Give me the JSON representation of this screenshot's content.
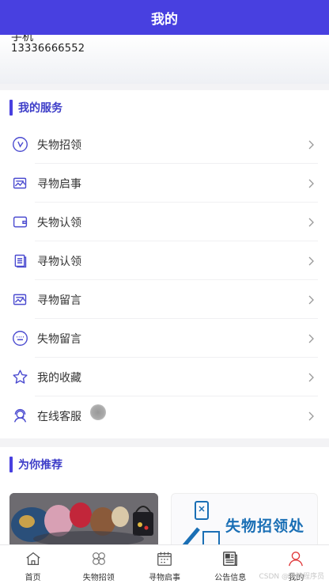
{
  "header": {
    "title": "我的"
  },
  "profile": {
    "name": "手机",
    "phone": "13336666552"
  },
  "services": {
    "title": "我的服务",
    "items": [
      {
        "label": "失物招领",
        "icon": "clock-circle-icon"
      },
      {
        "label": "寻物启事",
        "icon": "image-chart-icon"
      },
      {
        "label": "失物认领",
        "icon": "wallet-icon"
      },
      {
        "label": "寻物认领",
        "icon": "document-icon"
      },
      {
        "label": "寻物留言",
        "icon": "image-chart-icon"
      },
      {
        "label": "失物留言",
        "icon": "keyboard-circle-icon"
      },
      {
        "label": "我的收藏",
        "icon": "star-icon"
      },
      {
        "label": "在线客服",
        "icon": "headset-user-icon"
      }
    ]
  },
  "recommend": {
    "title": "为你推荐",
    "cards": [
      {
        "label": ""
      },
      {
        "label": "失物招领处"
      }
    ]
  },
  "tabbar": {
    "items": [
      {
        "label": "首页",
        "icon": "home-icon"
      },
      {
        "label": "失物招领",
        "icon": "grid-flower-icon"
      },
      {
        "label": "寻物启事",
        "icon": "calendar-icon"
      },
      {
        "label": "公告信息",
        "icon": "newspaper-icon"
      },
      {
        "label": "我的",
        "icon": "user-icon"
      }
    ],
    "active_index": 4
  },
  "watermark": "CSDN @黑鲸程序员",
  "colors": {
    "primary": "#4840e0",
    "section_title": "#3d3dc8",
    "active_tab": "#e0383a"
  }
}
